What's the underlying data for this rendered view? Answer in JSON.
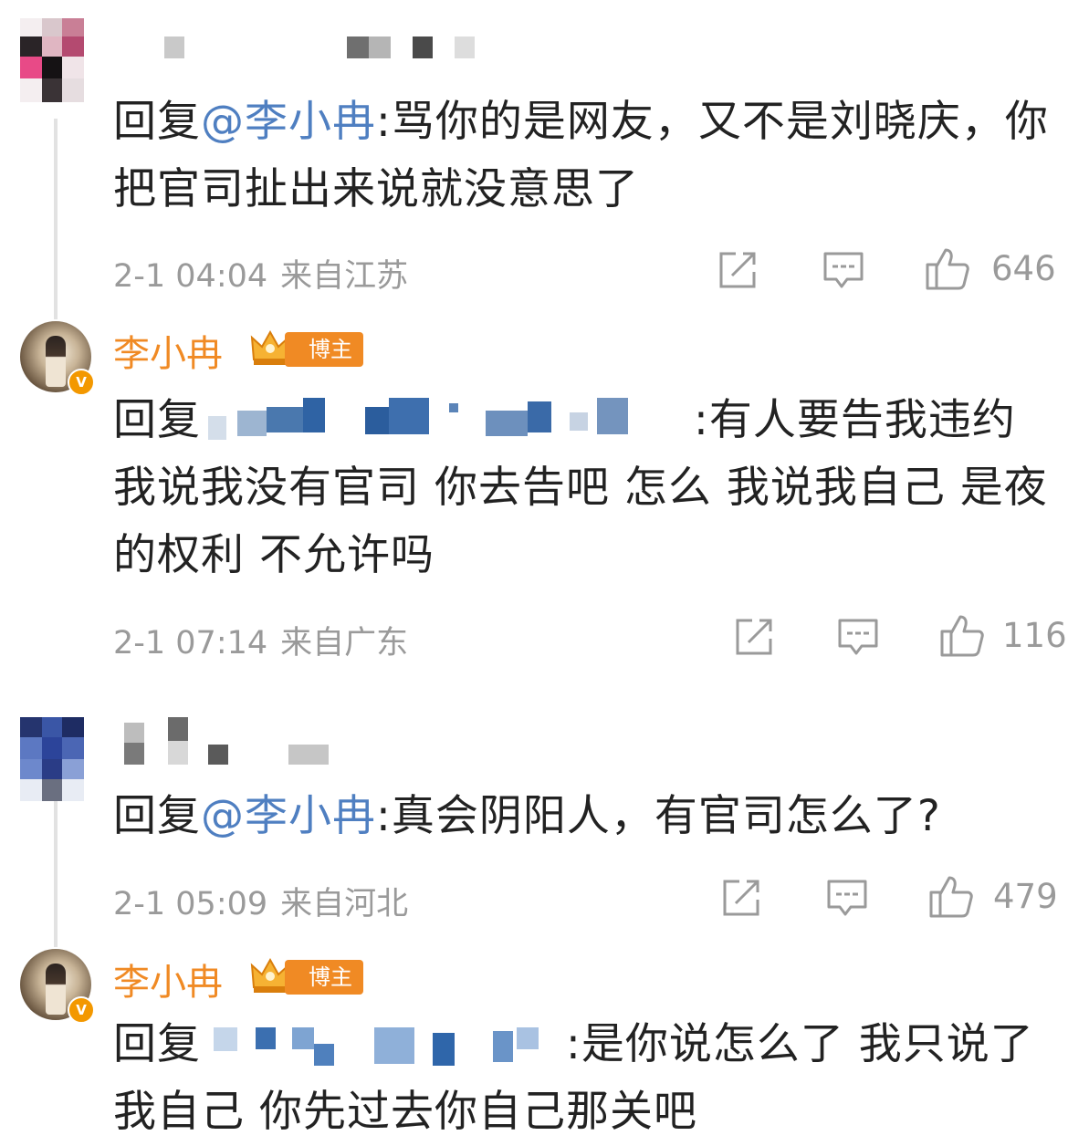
{
  "comments": [
    {
      "reply_prefix": "回复",
      "mention": "@李小冉",
      "text": ":骂你的是网友，又不是刘晓庆，你把官司扯出来说就没意思了",
      "date": "2-1 04:04",
      "location": "来自江苏",
      "likes": "646"
    },
    {
      "author": "李小冉",
      "badge": "博主",
      "reply_prefix": "回复",
      "text": ":有人要告我违约 我说我没有官司 你去告吧 怎么 我说我自己 是夜的权利 不允许吗",
      "date": "2-1 07:14",
      "location": "来自广东",
      "likes": "116"
    },
    {
      "reply_prefix": "回复",
      "mention": "@李小冉",
      "text": ":真会阴阳人，有官司怎么了?",
      "date": "2-1 05:09",
      "location": "来自河北",
      "likes": "479"
    },
    {
      "author": "李小冉",
      "badge": "博主",
      "reply_prefix": "回复",
      "text": ":是你说怎么了 我只说了我自己 你先过去你自己那关吧"
    }
  ],
  "icons": {
    "share": "share-icon",
    "comment": "comment-icon",
    "like": "thumbs-up-icon",
    "verified": "verified-v-icon",
    "crown": "crown-icon"
  },
  "colors": {
    "mention": "#4f7fc1",
    "author_name": "#f08a24",
    "badge_bg": "#f08a24",
    "meta_text": "#9a9a9a"
  }
}
